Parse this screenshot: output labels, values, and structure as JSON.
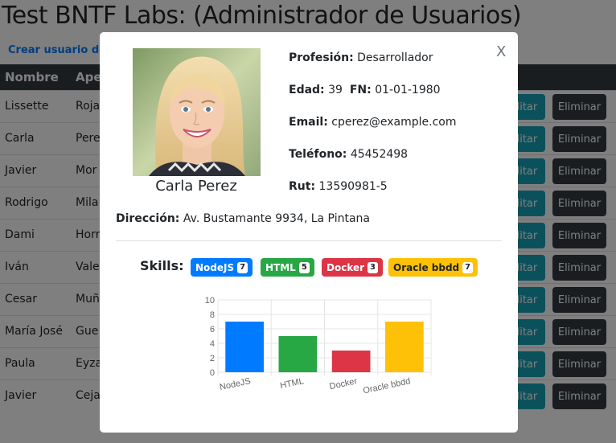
{
  "page": {
    "title": "Test BNTF Labs: (Administrador de Usuarios)",
    "create_link": "Crear usuario de ...",
    "columns": [
      "Nombre",
      "Ape"
    ],
    "rows": [
      {
        "nombre": "Lissette",
        "apellido": "Roja"
      },
      {
        "nombre": "Carla",
        "apellido": "Pere"
      },
      {
        "nombre": "Javier",
        "apellido": "Mor"
      },
      {
        "nombre": "Rodrigo",
        "apellido": "Mila"
      },
      {
        "nombre": "Dami",
        "apellido": "Horr"
      },
      {
        "nombre": "Iván",
        "apellido": "Vale"
      },
      {
        "nombre": "Cesar",
        "apellido": "Muñ"
      },
      {
        "nombre": "María José",
        "apellido": "Gue"
      },
      {
        "nombre": "Paula",
        "apellido": "Eyza"
      },
      {
        "nombre": "Javier",
        "apellido": "Ceja"
      }
    ],
    "edit_label": "Editar",
    "delete_label": "Eliminar"
  },
  "modal": {
    "close_label": "X",
    "name": "Carla Perez",
    "profesion_label": "Profesión:",
    "profesion": "Desarrollador",
    "edad_label": "Edad:",
    "edad": "39",
    "fn_label": "FN:",
    "fn": "01-01-1980",
    "email_label": "Email:",
    "email": "cperez@example.com",
    "telefono_label": "Teléfono:",
    "telefono": "45452498",
    "rut_label": "Rut:",
    "rut": "13590981-5",
    "direccion_label": "Dirección:",
    "direccion": "Av. Bustamante 9934, La Pintana",
    "skills_label": "Skills:",
    "skills": [
      {
        "name": "NodeJS",
        "count": "7",
        "color": "#007bff"
      },
      {
        "name": "HTML",
        "count": "5",
        "color": "#28a745"
      },
      {
        "name": "Docker",
        "count": "3",
        "color": "#dc3545"
      },
      {
        "name": "Oracle bbdd",
        "count": "7",
        "color": "#ffc107"
      }
    ]
  },
  "chart_data": {
    "type": "bar",
    "categories": [
      "NodeJS",
      "HTML",
      "Docker",
      "Oracle bbdd"
    ],
    "values": [
      7,
      5,
      3,
      7
    ],
    "colors": [
      "#007bff",
      "#28a745",
      "#dc3545",
      "#ffc107"
    ],
    "ylim": [
      0,
      10
    ],
    "yticks": [
      "0",
      "2",
      "4",
      "6",
      "8",
      "10"
    ],
    "grid": true
  }
}
